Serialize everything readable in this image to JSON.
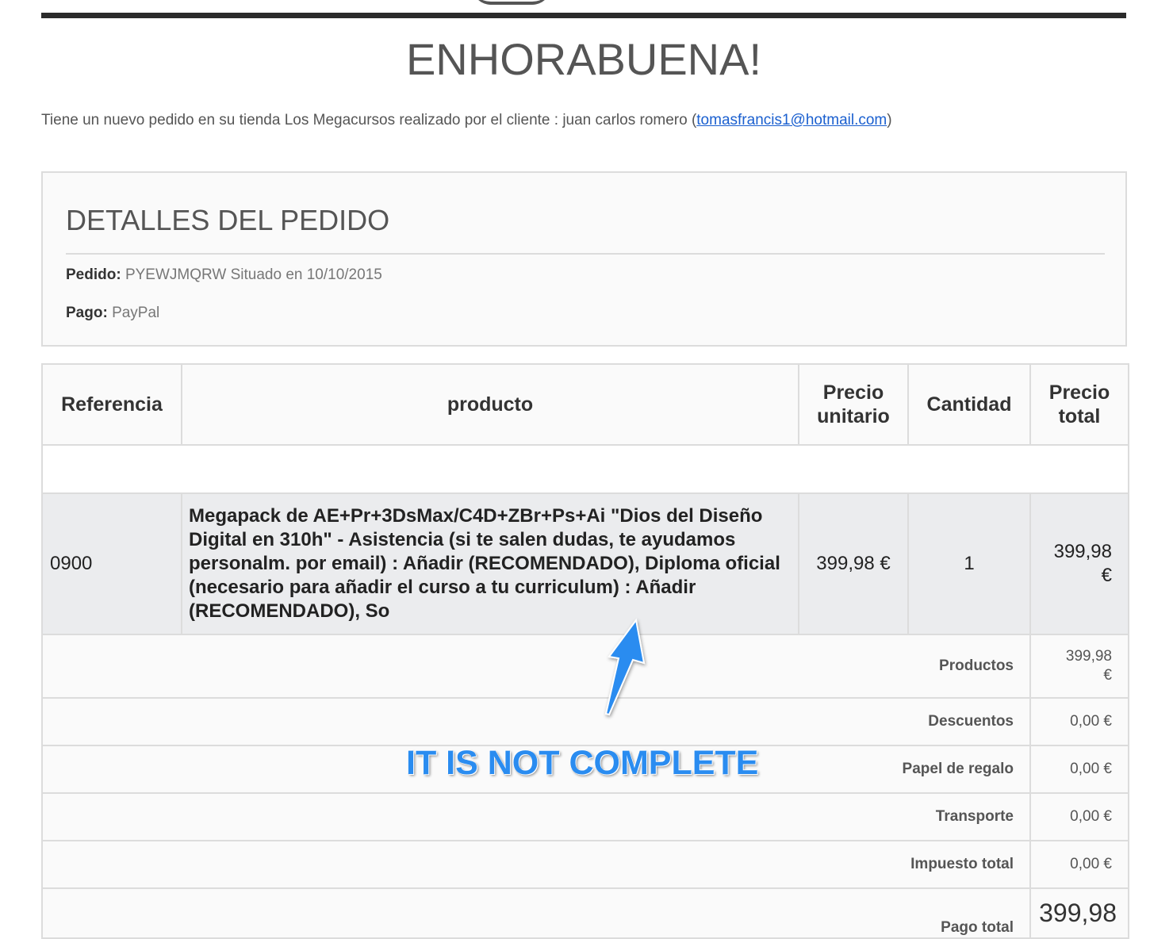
{
  "header": {
    "title": "ENHORABUENA!"
  },
  "intro": {
    "text": "Tiene un nuevo pedido en su tienda Los Megacursos realizado por el cliente : juan carlos romero (",
    "email": "tomasfrancis1@hotmail.com",
    "suffix": ")"
  },
  "details": {
    "title": "DETALLES DEL PEDIDO",
    "order_label": "Pedido:",
    "order_value": "PYEWJMQRW Situado en 10/10/2015",
    "payment_label": "Pago:",
    "payment_value": "PayPal"
  },
  "table": {
    "headers": {
      "reference": "Referencia",
      "product": "producto",
      "unit_price_line1": "Precio",
      "unit_price_line2": "unitario",
      "quantity": "Cantidad",
      "total_price_line1": "Precio",
      "total_price_line2": "total"
    },
    "rows": [
      {
        "reference": "0900",
        "product": "Megapack de AE+Pr+3DsMax/C4D+ZBr+Ps+Ai \"Dios del Diseño Digital en 310h\" - Asistencia (si te salen dudas, te ayudamos personalm. por email) : Añadir (RECOMENDADO), Diploma oficial (necesario para añadir el curso a tu curriculum) : Añadir (RECOMENDADO), So",
        "unit_price": "399,98 €",
        "quantity": "1",
        "total_line1": "399,98",
        "total_line2": "€"
      }
    ]
  },
  "summary": {
    "products_label": "Productos",
    "products_value_line1": "399,98",
    "products_value_line2": "€",
    "discounts_label": "Descuentos",
    "discounts_value": "0,00 €",
    "giftwrap_label": "Papel de regalo",
    "giftwrap_value": "0,00 €",
    "shipping_label": "Transporte",
    "shipping_value": "0,00 €",
    "tax_label": "Impuesto total",
    "tax_value": "0,00 €",
    "grand_label": "Pago total",
    "grand_value": "399,98"
  },
  "annotation": {
    "text": "IT IS NOT COMPLETE",
    "color": "#2a8cf0"
  }
}
